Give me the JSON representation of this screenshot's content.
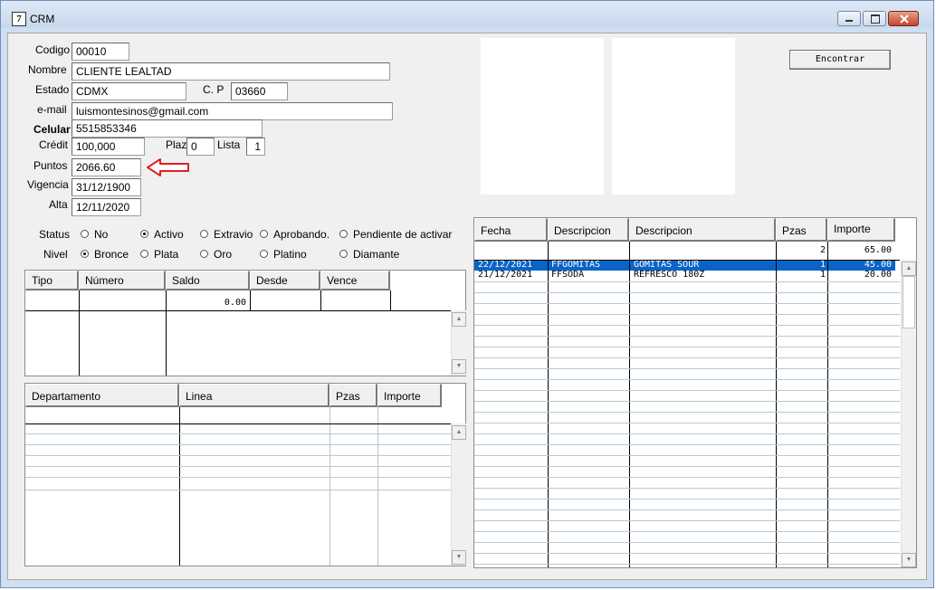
{
  "window": {
    "title": "CRM",
    "icon_glyph": "7"
  },
  "form": {
    "codigo": {
      "label": "Codigo",
      "value": "00010"
    },
    "nombre": {
      "label": "Nombre",
      "value": "CLIENTE LEALTAD"
    },
    "estado": {
      "label": "Estado",
      "value": "CDMX"
    },
    "cp": {
      "label": "C. P",
      "value": "03660"
    },
    "email": {
      "label": "e-mail",
      "value": "luismontesinos@gmail.com"
    },
    "celular": {
      "label": "Celular",
      "value": "5515853346"
    },
    "credito": {
      "label": "Crédit",
      "value": "100,000"
    },
    "plazo": {
      "label": "Plaz",
      "value": "0"
    },
    "lista": {
      "label": "Lista",
      "value": "1"
    },
    "puntos": {
      "label": "Puntos",
      "value": "2066.60"
    },
    "vigencia": {
      "label": "Vigencia",
      "value": "31/12/1900"
    },
    "alta": {
      "label": "Alta",
      "value": "12/11/2020"
    }
  },
  "status": {
    "label": "Status",
    "options": [
      "No",
      "Activo",
      "Extravio",
      "Aprobando.",
      "Pendiente de activar"
    ],
    "selected": "Activo"
  },
  "nivel": {
    "label": "Nivel",
    "options": [
      "Bronce",
      "Plata",
      "Oro",
      "Platino",
      "Diamante"
    ],
    "selected": "Bronce"
  },
  "encontrar_button": "Encontrar",
  "cards_table": {
    "columns": [
      "Tipo",
      "Número",
      "Saldo",
      "Desde",
      "Vence"
    ],
    "rows": [
      [
        "",
        "",
        "0.00",
        "",
        ""
      ]
    ]
  },
  "dept_table": {
    "columns": [
      "Departamento",
      "Linea",
      "Pzas",
      "Importe"
    ]
  },
  "sales_table": {
    "columns": [
      "Fecha",
      "Descripcion",
      "Descripcion",
      "Pzas",
      "Importe"
    ],
    "totals": {
      "pzas": "2",
      "importe": "65.00"
    },
    "rows": [
      {
        "fecha": "22/12/2021",
        "codigo": "FFGOMITAS",
        "descripcion": "GOMITAS SOUR",
        "pzas": "1",
        "importe": "45.00",
        "selected": true
      },
      {
        "fecha": "21/12/2021",
        "codigo": "FFSODA",
        "descripcion": "REFRESCO 180Z",
        "pzas": "1",
        "importe": "20.00",
        "selected": false
      }
    ]
  },
  "colors": {
    "selection": "#0a64c8",
    "annotation_arrow": "#e02020",
    "title_bar": "#cfdff0"
  },
  "icons": [
    "app-icon",
    "minimize-icon",
    "maximize-icon",
    "close-icon",
    "red-arrow-icon",
    "scroll-up-icon",
    "scroll-down-icon"
  ]
}
